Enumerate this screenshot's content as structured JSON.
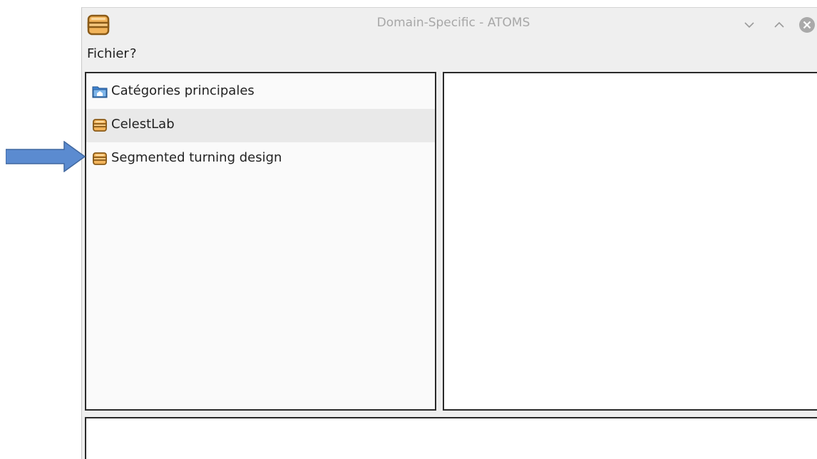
{
  "window": {
    "title": "Domain-Specific - ATOMS",
    "app_icon": "archive-box-icon",
    "controls": [
      "minimize-icon",
      "maximize-icon",
      "close-icon"
    ]
  },
  "menu": {
    "items": [
      {
        "label": "Fichier"
      },
      {
        "label": "?"
      }
    ]
  },
  "tree": {
    "items": [
      {
        "label": "Catégories principales",
        "icon": "folder-home-icon",
        "selected": false
      },
      {
        "label": "CelestLab",
        "icon": "archive-box-icon",
        "selected": true
      },
      {
        "label": "Segmented turning design",
        "icon": "archive-box-icon",
        "selected": false
      }
    ]
  },
  "annotation": {
    "icon": "arrow-right-icon",
    "color": "#5b8bd0"
  },
  "colors": {
    "archive_fill": "#f2b45b",
    "archive_stroke": "#8a5a17",
    "folder_blue": "#4a8fd8",
    "selection": "#e9e9e9"
  }
}
